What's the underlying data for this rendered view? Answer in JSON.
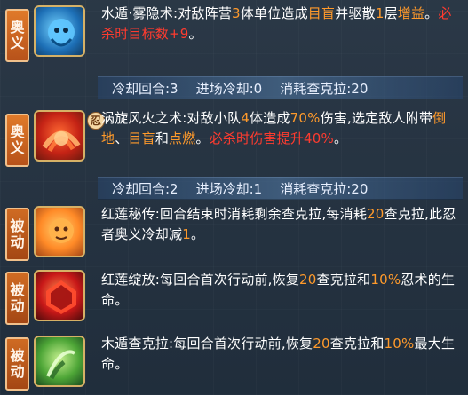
{
  "skills": [
    {
      "type_label": "奥义",
      "icon": "water-ninja-icon",
      "segments": [
        {
          "t": "水遁·雾隐术:对敌阵营",
          "c": "w"
        },
        {
          "t": "3",
          "c": "o"
        },
        {
          "t": "体单位造成",
          "c": "w"
        },
        {
          "t": "目盲",
          "c": "o"
        },
        {
          "t": "并驱散",
          "c": "w"
        },
        {
          "t": "1",
          "c": "o"
        },
        {
          "t": "层",
          "c": "w"
        },
        {
          "t": "增益",
          "c": "o"
        },
        {
          "t": "。",
          "c": "w"
        },
        {
          "t": "必杀时目标数+9",
          "c": "r"
        },
        {
          "t": "。",
          "c": "w"
        }
      ],
      "cooldown": {
        "label_round": "冷却回合:3",
        "label_enter": "进场冷却:0",
        "label_cost": "消耗查克拉:20"
      }
    },
    {
      "type_label": "奥义",
      "icon": "fire-vortex-icon",
      "segments": [
        {
          "t": "涡旋风火之术:对敌小队",
          "c": "w"
        },
        {
          "t": "4",
          "c": "o"
        },
        {
          "t": "体造成",
          "c": "w"
        },
        {
          "t": "70%",
          "c": "o"
        },
        {
          "t": "伤害,选定敌人附带",
          "c": "w"
        },
        {
          "t": "倒地",
          "c": "o"
        },
        {
          "t": "、",
          "c": "w"
        },
        {
          "t": "目盲",
          "c": "o"
        },
        {
          "t": "和",
          "c": "w"
        },
        {
          "t": "点燃",
          "c": "o"
        },
        {
          "t": "。",
          "c": "w"
        },
        {
          "t": "必杀时伤害提升40%",
          "c": "r"
        },
        {
          "t": "。",
          "c": "w"
        }
      ],
      "cooldown": {
        "label_round": "冷却回合:2",
        "label_enter": "进场冷却:1",
        "label_cost": "消耗查克拉:20"
      }
    },
    {
      "type_label": "被动",
      "icon": "red-lotus-secret-icon",
      "segments": [
        {
          "t": "红莲秘传:回合结束时消耗剩余查克拉,每消耗",
          "c": "w"
        },
        {
          "t": "20",
          "c": "o"
        },
        {
          "t": "查克拉,此忍者奥义冷却减",
          "c": "w"
        },
        {
          "t": "1",
          "c": "o"
        },
        {
          "t": "。",
          "c": "w"
        }
      ]
    },
    {
      "type_label": "被动",
      "icon": "red-lotus-bloom-icon",
      "segments": [
        {
          "t": "红莲绽放:每回合首次行动前,恢复",
          "c": "w"
        },
        {
          "t": "20",
          "c": "o"
        },
        {
          "t": "查克拉和",
          "c": "w"
        },
        {
          "t": "10%",
          "c": "o"
        },
        {
          "t": "忍术的生命。",
          "c": "w"
        }
      ]
    },
    {
      "type_label": "被动",
      "icon": "wood-release-icon",
      "segments": [
        {
          "t": "木遁查克拉:每回合首次行动前,恢复",
          "c": "w"
        },
        {
          "t": "20",
          "c": "o"
        },
        {
          "t": "查克拉和",
          "c": "w"
        },
        {
          "t": "10%",
          "c": "o"
        },
        {
          "t": "最大生命。",
          "c": "w"
        }
      ]
    }
  ],
  "small_icon_label": "忍"
}
